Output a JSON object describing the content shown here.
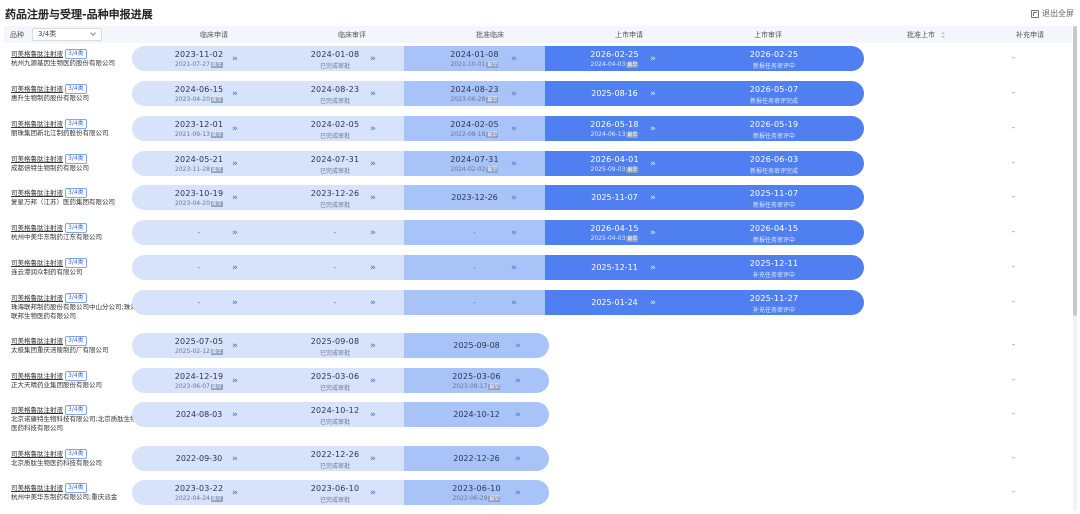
{
  "page": {
    "title": "药品注册与受理-品种申报进展",
    "exit_fullscreen": "退出全屏"
  },
  "header": {
    "filter_label": "品种",
    "filter_value": "3/4类",
    "columns": [
      "临床申请",
      "临床审评",
      "批准临床",
      "上市申请",
      "上市审评",
      "批准上市",
      "补充申请"
    ]
  },
  "common": {
    "drug_name": "司美格鲁肽注射液",
    "drug_class": "3/4类",
    "approved_text": "已完成审批",
    "done_tag": "最早",
    "dash": "-"
  },
  "colors": {
    "light": "#d6e3fb",
    "mid": "#a8c3f7",
    "dark": "#4f7ff0"
  },
  "rows": [
    {
      "company": "杭州九源基因生物医药股份有限公司",
      "cells": [
        {
          "d": "2023-11-02",
          "s": "2021-07-27",
          "tag": true
        },
        {
          "d": "2024-01-08",
          "s": "已完成审批"
        },
        {
          "d": "2024-01-08",
          "s": "2021-10-01",
          "tag": true
        },
        {
          "d": "2026-02-25",
          "s": "2024-04-03",
          "tag": true
        },
        {
          "d": "2026-02-25",
          "s": "新报任务审评中"
        }
      ],
      "supp": "-"
    },
    {
      "company": "惠升生物制药股份有限公司",
      "cells": [
        {
          "d": "2024-06-15",
          "s": "2023-04-20",
          "tag": true
        },
        {
          "d": "2024-08-23",
          "s": "已完成审批"
        },
        {
          "d": "2024-08-23",
          "s": "2023-06-28",
          "tag": true
        },
        {
          "d": "2025-08-16",
          "s": ""
        },
        {
          "d": "2026-05-07",
          "s": "新报任务审评完成"
        }
      ],
      "supp": "-"
    },
    {
      "company": "丽珠集团新北江制药股份有限公司",
      "cells": [
        {
          "d": "2023-12-01",
          "s": "2021-09-13",
          "tag": true
        },
        {
          "d": "2024-02-05",
          "s": "已完成审批"
        },
        {
          "d": "2024-02-05",
          "s": "2022-08-18",
          "tag": true
        },
        {
          "d": "2026-05-18",
          "s": "2024-06-13",
          "tag": true
        },
        {
          "d": "2026-05-19",
          "s": "新报任务审评中"
        }
      ],
      "supp": "-"
    },
    {
      "company": "成都倍特生物制药有限公司",
      "cells": [
        {
          "d": "2024-05-21",
          "s": "2023-11-28",
          "tag": true
        },
        {
          "d": "2024-07-31",
          "s": "已完成审批"
        },
        {
          "d": "2024-07-31",
          "s": "2024-02-02",
          "tag": true
        },
        {
          "d": "2026-04-01",
          "s": "2025-09-03",
          "tag": true
        },
        {
          "d": "2026-06-03",
          "s": "新报任务审评完成"
        }
      ],
      "supp": "-"
    },
    {
      "company": "复星万邦（江苏）医药集团有限公司",
      "cells": [
        {
          "d": "2023-10-19",
          "s": "2023-04-20",
          "tag": true
        },
        {
          "d": "2023-12-26",
          "s": "已完成审批"
        },
        {
          "d": "2023-12-26",
          "s": ""
        },
        {
          "d": "2025-11-07",
          "s": ""
        },
        {
          "d": "2025-11-07",
          "s": "新报任务审评中"
        }
      ],
      "supp": "-"
    },
    {
      "company": "杭州中美华东制药江东有限公司",
      "cells": [
        {
          "d": "-",
          "s": ""
        },
        {
          "d": "-",
          "s": ""
        },
        {
          "d": "-",
          "s": ""
        },
        {
          "d": "2026-04-15",
          "s": "2025-04-03",
          "tag": true
        },
        {
          "d": "2026-04-15",
          "s": "新报任务审评中"
        }
      ],
      "supp": "-"
    },
    {
      "company": "连云港润众制药有限公司",
      "cells": [
        {
          "d": "-",
          "s": ""
        },
        {
          "d": "-",
          "s": ""
        },
        {
          "d": "-",
          "s": ""
        },
        {
          "d": "2025-12-11",
          "s": ""
        },
        {
          "d": "2025-12-11",
          "s": "补充任务审评中"
        }
      ],
      "supp": "-"
    },
    {
      "company": "珠海联邦制药股份有限公司中山分公司;珠海联邦生物医药有限公司",
      "cells": [
        {
          "d": "-",
          "s": ""
        },
        {
          "d": "-",
          "s": ""
        },
        {
          "d": "-",
          "s": ""
        },
        {
          "d": "2025-01-24",
          "s": ""
        },
        {
          "d": "2025-11-27",
          "s": "补充任务审评中"
        }
      ],
      "supp": "-"
    },
    {
      "company": "太极集团重庆涪陵制药厂有限公司",
      "cells": [
        {
          "d": "2025-07-05",
          "s": "2025-02-12",
          "tag": true
        },
        {
          "d": "2025-09-08",
          "s": "已完成审批"
        },
        {
          "d": "2025-09-08",
          "s": ""
        }
      ],
      "supp": "-"
    },
    {
      "company": "正大天晴药业集团股份有限公司",
      "cells": [
        {
          "d": "2024-12-19",
          "s": "2023-06-07",
          "tag": true
        },
        {
          "d": "2025-03-06",
          "s": "已完成审批"
        },
        {
          "d": "2025-03-06",
          "s": "2023-08-17",
          "tag": true
        }
      ],
      "supp": "-"
    },
    {
      "company": "北京诺康特生物科技有限公司;北京质肽生物医药科技有限公司",
      "cells": [
        {
          "d": "2024-08-03",
          "s": ""
        },
        {
          "d": "2024-10-12",
          "s": "已完成审批"
        },
        {
          "d": "2024-10-12",
          "s": ""
        }
      ],
      "supp": "-"
    },
    {
      "company": "北京质肽生物医药科技有限公司",
      "cells": [
        {
          "d": "2022-09-30",
          "s": ""
        },
        {
          "d": "2022-12-26",
          "s": "已完成审批"
        },
        {
          "d": "2022-12-26",
          "s": ""
        }
      ],
      "supp": "-"
    },
    {
      "company": "杭州中美华东制药有限公司;重庆派金",
      "cells": [
        {
          "d": "2023-03-22",
          "s": "2022-04-24",
          "tag": true
        },
        {
          "d": "2023-06-10",
          "s": "已完成审批"
        },
        {
          "d": "2023-06-10",
          "s": "2022-06-29",
          "tag": true
        }
      ],
      "supp": "-"
    }
  ]
}
